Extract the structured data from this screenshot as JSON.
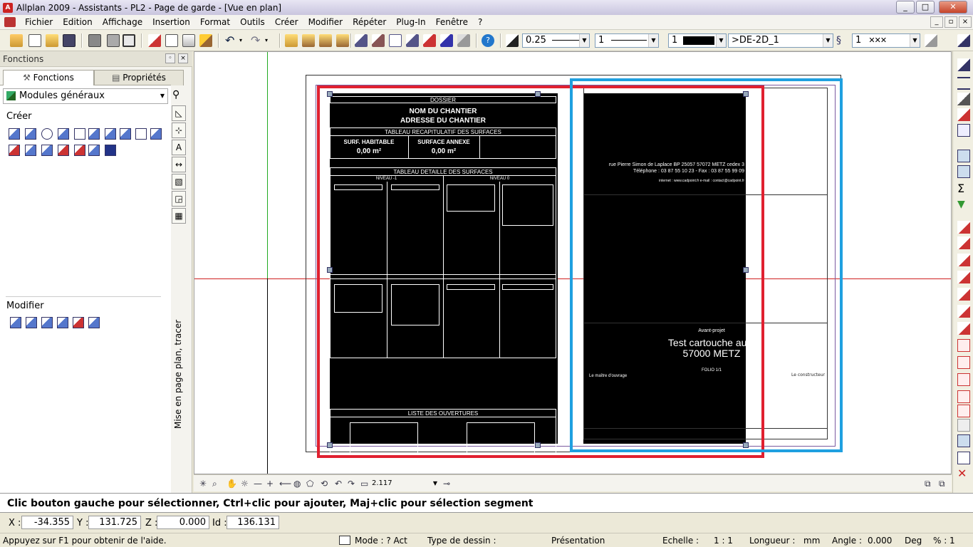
{
  "window": {
    "title": "Allplan 2009 - Assistants - PL2 - Page de garde - [Vue en plan]",
    "minimize": "_",
    "maximize": "□",
    "close": "✕"
  },
  "menu": [
    "Fichier",
    "Edition",
    "Affichage",
    "Insertion",
    "Format",
    "Outils",
    "Créer",
    "Modifier",
    "Répéter",
    "Plug-In",
    "Fenêtre",
    "?"
  ],
  "toolbar": {
    "pen_thickness": "0.25",
    "line_type": "1",
    "color": "1",
    "layer": ">DE-2D_1",
    "pattern": "1"
  },
  "left_panel": {
    "header": "Fonctions",
    "tabs": [
      "Fonctions",
      "Propriétés"
    ],
    "module": "Modules généraux",
    "section_create": "Créer",
    "section_modify": "Modifier",
    "vertical_label": "Mise en page plan, tracer"
  },
  "drawing": {
    "dossier": "DOSSIER",
    "site_name": "NOM DU CHANTIER",
    "site_address": "ADRESSE DU CHANTIER",
    "summary_title": "TABLEAU RECAPITULATIF DES SURFACES",
    "surf_habitable": "SURF. HABITABLE",
    "surf_annexe": "SURFACE ANNEXE",
    "surf_habitable_val": "0,00 m²",
    "surf_annexe_val": "0,00 m²",
    "detail_title": "TABLEAU DETAILLE DES SURFACES",
    "level_minus1": "NIVEAU -1",
    "level_0": "NIVEAU 0",
    "openings_title": "LISTE DES OUVERTURES",
    "address_line": "rue Pierre Simon de Laplace BP 25057  57072 METZ cedex 3",
    "phone_line": "Téléphone : 03 87 55 10 23 - Fax : 03 87 55 99 09",
    "web_line": "internet : www.cadpoint.fr  e-mail : contact@cadpoint.fr",
    "project_label": "Avant-projet",
    "project_name": "Test cartouche auto",
    "project_city": "57000 METZ",
    "folio": "FOLIO 1/1",
    "owner": "Le maître d'ouvrage",
    "builder": "Le constructeur"
  },
  "view_toolbar": {
    "zoom": "2.117"
  },
  "message": "Clic bouton gauche pour sélectionner, Ctrl+clic pour ajouter, Maj+clic pour sélection segment",
  "coords": {
    "x_label": "X :",
    "x": "-34.355",
    "y_label": "Y :",
    "y": "131.725",
    "z_label": "Z :",
    "z": "0.000",
    "id_label": "Id :",
    "id": "136.131"
  },
  "statusbar": {
    "help": "Appuyez sur F1 pour obtenir de l'aide.",
    "mode": "Mode :  ? Act",
    "drawing_type_label": "Type de dessin :",
    "drawing_type": "Présentation",
    "scale_label": "Echelle :",
    "scale": "1 : 1",
    "length_label": "Longueur :",
    "length_unit": "mm",
    "angle_label": "Angle :",
    "angle": "0.000",
    "angle_unit": "Deg",
    "percent_label": "% :",
    "percent": "1"
  },
  "colors": {
    "selection_red": "#e02030",
    "selection_blue": "#1fa0e0",
    "sheet_black": "#000000"
  }
}
